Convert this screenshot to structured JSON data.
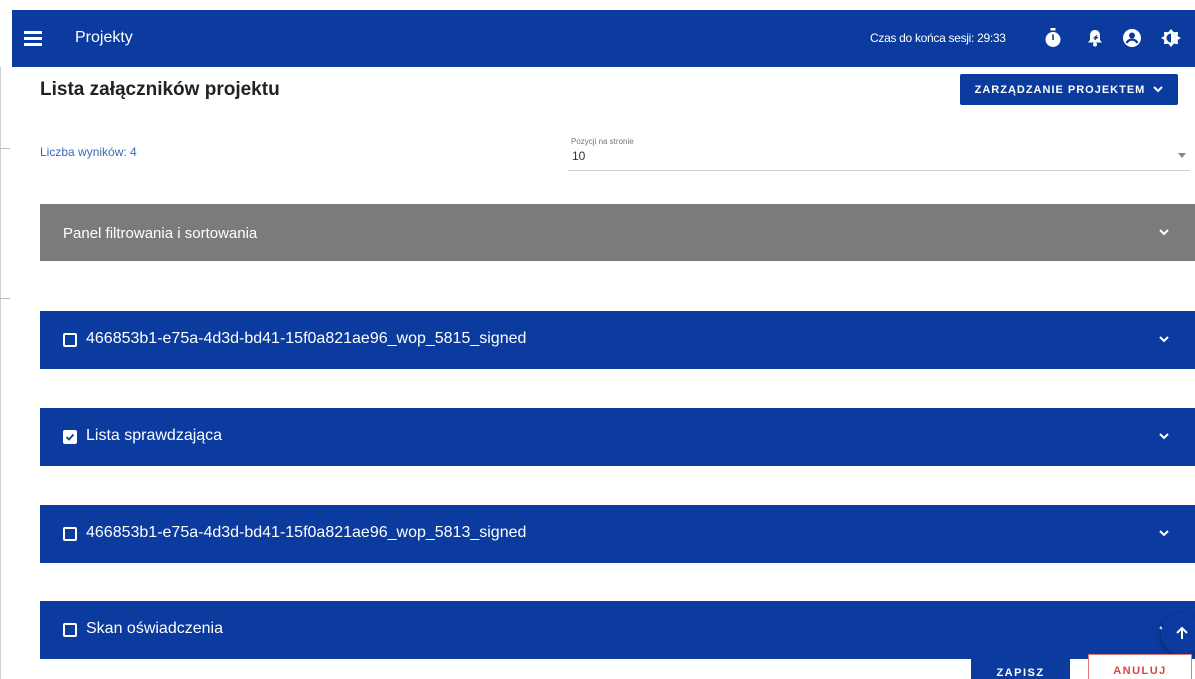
{
  "topbar": {
    "menu_icon": "hamburger-menu-icon",
    "title": "Projekty",
    "session_text": "Czas do końca sesji: 29:33",
    "icons": [
      "timer-icon",
      "notifications-bell-icon",
      "account-circle-icon",
      "contrast-icon"
    ]
  },
  "page": {
    "title": "Lista załączników projektu",
    "manage_button": "ZARZĄDZANIE PROJEKTEM",
    "results_count": "Liczba wyników: 4",
    "per_page_label": "Pozycji na stronie",
    "per_page_value": "10"
  },
  "filter_panel": {
    "label": "Panel filtrowania i sortowania"
  },
  "attachments": [
    {
      "label": "466853b1-e75a-4d3d-bd41-15f0a821ae96_wop_5815_signed",
      "checked": false
    },
    {
      "label": "Lista sprawdzająca",
      "checked": true
    },
    {
      "label": "466853b1-e75a-4d3d-bd41-15f0a821ae96_wop_5813_signed",
      "checked": false
    },
    {
      "label": "Skan oświadczenia",
      "checked": false
    }
  ],
  "actions": {
    "save": "ZAPISZ",
    "cancel": "ANULUJ"
  },
  "colors": {
    "primary": "#0b3b9e",
    "filter_panel": "#7b7b7b",
    "cancel": "#d64545",
    "link": "#3a6ab7"
  }
}
